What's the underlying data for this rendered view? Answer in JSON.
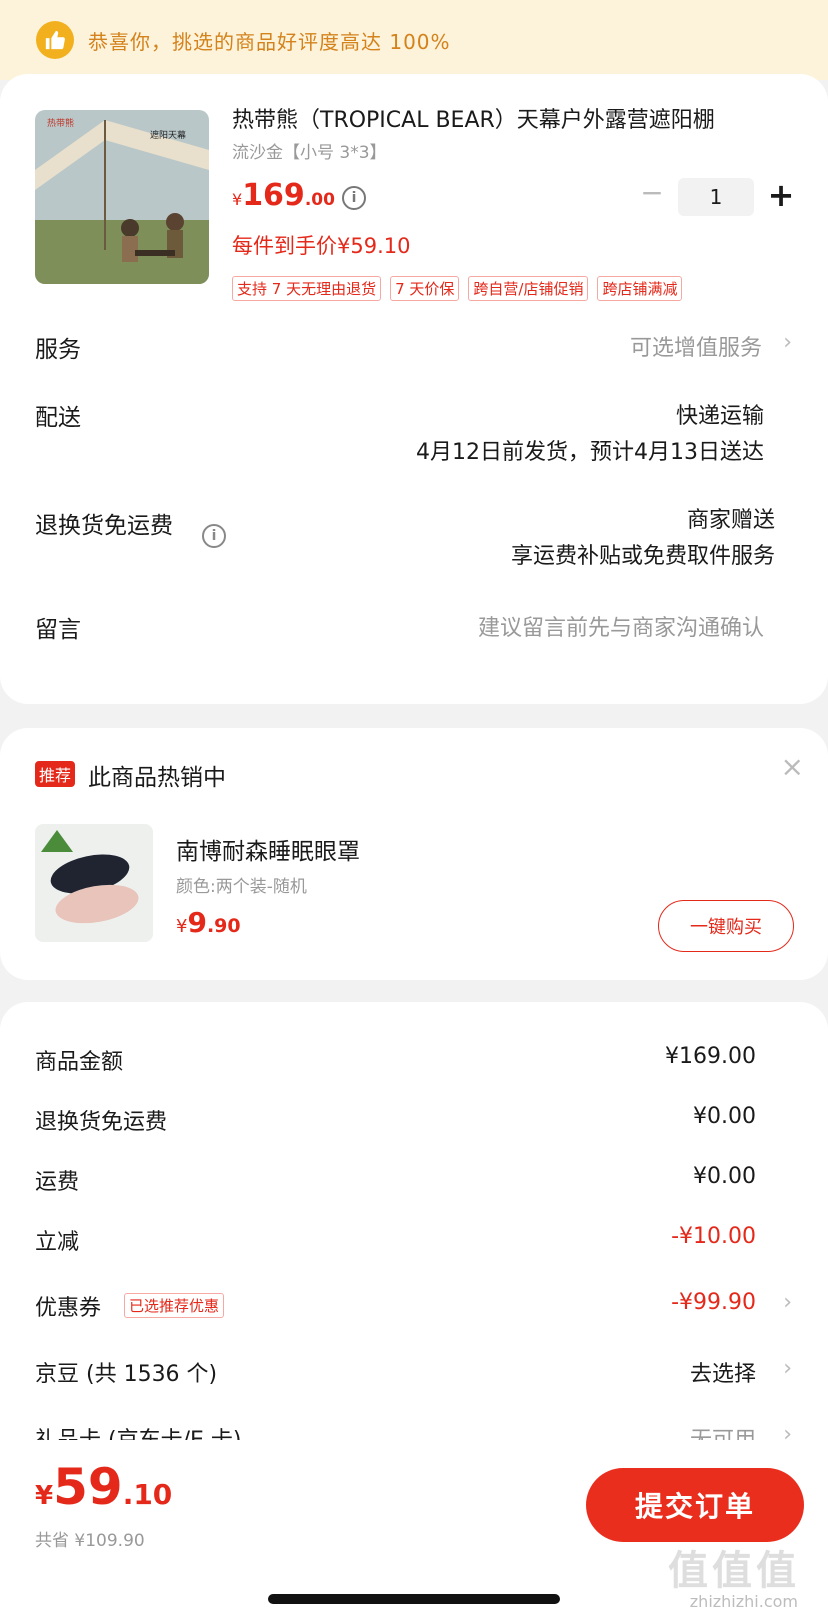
{
  "banner": {
    "icon": "thumbs-up-icon",
    "text": "恭喜你，挑选的商品好评度高达 100%"
  },
  "product": {
    "title": "热带熊（TROPICAL BEAR）天幕户外露营遮阳棚",
    "spec": "流沙金【小号 3*3】",
    "price_currency": "¥",
    "price_int": "169",
    "price_dec": ".00",
    "per_item_price": "每件到手价¥59.10",
    "quantity": "1",
    "minus": "−",
    "plus": "+",
    "tags": [
      "支持 7 天无理由退货",
      "7 天价保",
      "跨自营/店铺促销",
      "跨店铺满减"
    ],
    "image_text": {
      "brand": "热带熊",
      "caption": "遮阳天幕"
    }
  },
  "rows": {
    "service": {
      "label": "服务",
      "value": "可选增值服务"
    },
    "delivery": {
      "label": "配送",
      "method": "快递运输",
      "schedule": "4月12日前发货，预计4月13日送达"
    },
    "return": {
      "label": "退换货免运费",
      "value1": "商家赠送",
      "value2": "享运费补贴或免费取件服务"
    },
    "message": {
      "label": "留言",
      "placeholder": "建议留言前先与商家沟通确认"
    }
  },
  "recommend": {
    "badge": "推荐",
    "title": "此商品热销中",
    "close": "×",
    "name": "南博耐森睡眠眼罩",
    "spec": "颜色:两个装-随机",
    "price_currency": "¥",
    "price_int": "9",
    "price_dec": ".90",
    "buy_label": "一键购买"
  },
  "summary": {
    "goods": {
      "label": "商品金额",
      "value": "¥169.00"
    },
    "return_free": {
      "label": "退换货免运费",
      "value": "¥0.00"
    },
    "shipping": {
      "label": "运费",
      "value": "¥0.00"
    },
    "discount": {
      "label": "立减",
      "value": "-¥10.00"
    },
    "coupon": {
      "label": "优惠券",
      "tag": "已选推荐优惠",
      "value": "-¥99.90"
    },
    "jingdou": {
      "label": "京豆 (共 1536 个)",
      "value": "去选择"
    },
    "giftcard": {
      "label": "礼品卡 (京东卡/E 卡)",
      "value": "无可用"
    }
  },
  "bottom": {
    "currency": "¥",
    "total_int": "59",
    "total_dec": ".10",
    "saved": "共省 ¥109.90",
    "submit_label": "提交订单",
    "watermark": "值值值",
    "watermark_sub": "zhizhizhi.com"
  },
  "colors": {
    "accent": "#e4291a",
    "banner_bg": "#fdf3da",
    "banner_text": "#d4821b"
  }
}
